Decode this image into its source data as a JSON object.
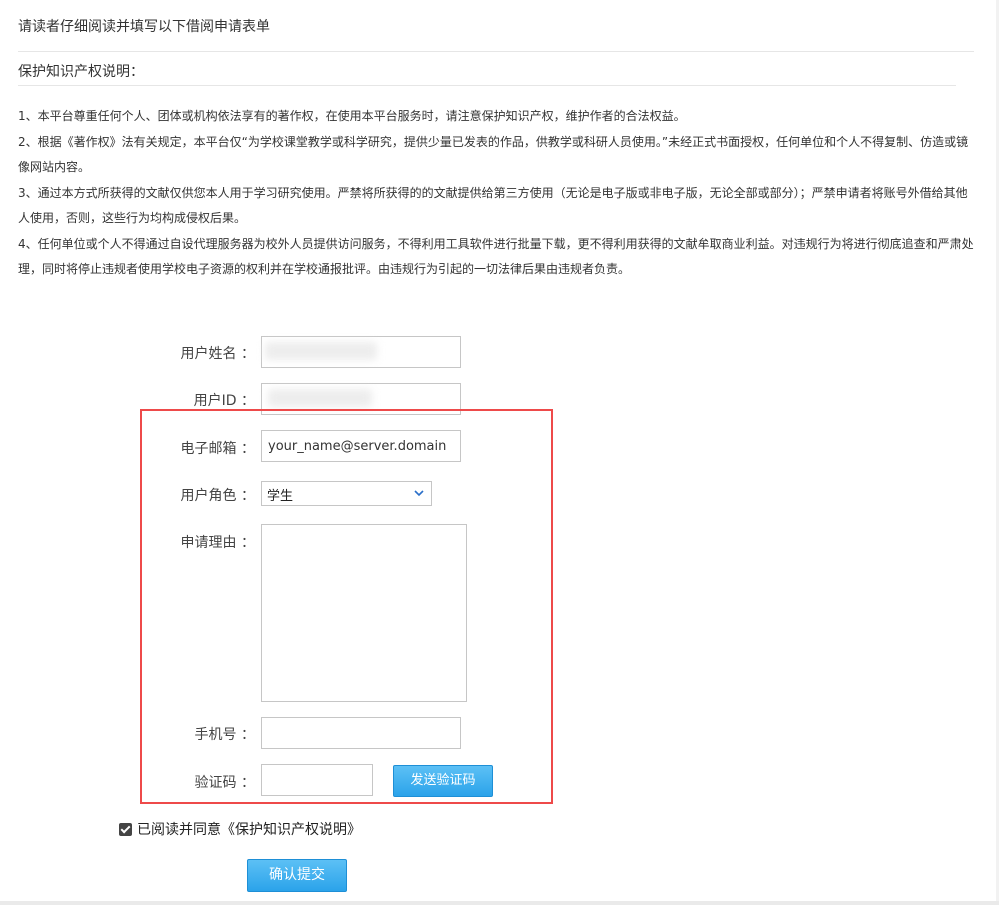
{
  "header": {
    "title": "请读者仔细阅读并填写以下借阅申请表单",
    "notice_title": "保护知识产权说明："
  },
  "notice": [
    "1、本平台尊重任何个人、团体或机构依法享有的著作权，在使用本平台服务时，请注意保护知识产权，维护作者的合法权益。",
    "2、根据《著作权》法有关规定，本平台仅“为学校课堂教学或科学研究，提供少量已发表的作品，供教学或科研人员使用。”未经正式书面授权，任何单位和个人不得复制、仿造或镜像网站内容。",
    "3、通过本方式所获得的文献仅供您本人用于学习研究使用。严禁将所获得的的文献提供给第三方使用（无论是电子版或非电子版，无论全部或部分）；严禁申请者将账号外借给其他人使用，否则，这些行为均构成侵权后果。",
    "4、任何单位或个人不得通过自设代理服务器为校外人员提供访问服务，不得利用工具软件进行批量下载，更不得利用获得的文献牟取商业利益。对违规行为将进行彻底追查和严肃处理，同时将停止违规者使用学校电子资源的权利并在学校通报批评。由违规行为引起的一切法律后果由违规者负责。"
  ],
  "form": {
    "username_label": "用户姓名 ：",
    "userid_label": "用户ID ：",
    "email_label": "电子邮箱 ：",
    "email_value": "your_name@server.domain",
    "role_label": "用户角色 ：",
    "role_value": "学生",
    "reason_label": "申请理由 ：",
    "phone_label": "手机号 ：",
    "captcha_label": "验证码 ：",
    "send_code_button": "发送验证码",
    "agree_text": "已阅读并同意《保护知识产权说明》",
    "submit_button": "确认提交",
    "highlight_color": "#ee4a4a"
  }
}
